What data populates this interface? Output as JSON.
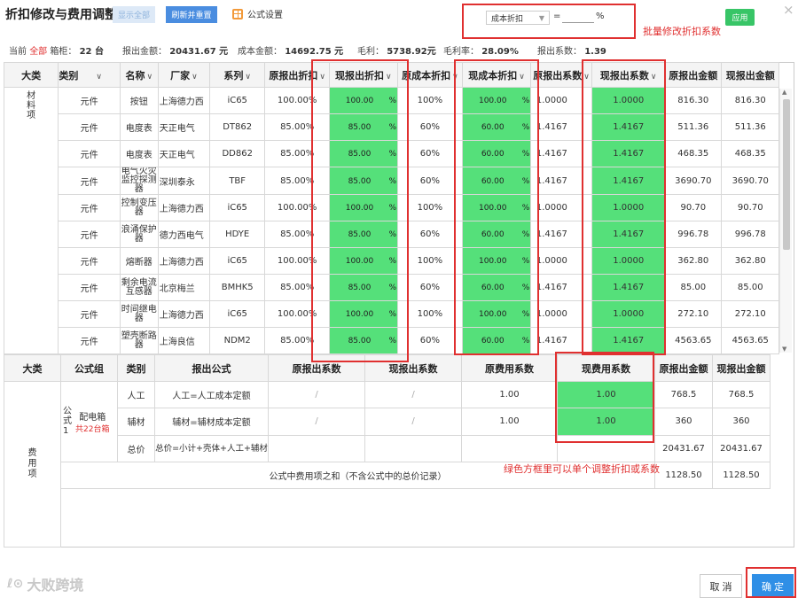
{
  "header": {
    "title": "折扣修改与费用调整",
    "show_all_label": "显示全部",
    "refresh_label": "刷新并重置",
    "formula_settings_label": "公式设置",
    "apply_label": "应用",
    "close_label": "×"
  },
  "batch": {
    "select_value": "成本折扣",
    "equals": "=",
    "input_value": "",
    "percent": "%",
    "note": "批量修改折扣系数"
  },
  "summary": {
    "current_label": "当前",
    "all_label": "全部",
    "cabinet_text": "箱柜：",
    "cabinet_value": "22 台",
    "quote_total_label": "报出金额：",
    "quote_total_value": "20431.67 元",
    "cost_total_label": "成本金额：",
    "cost_total_value": "14692.75 元",
    "gross_profit_label": "毛利：",
    "gross_profit_value": "5738.92元",
    "gross_margin_label": "毛利率：",
    "gross_margin_value": "28.09%",
    "quote_coef_label": "报出系数：",
    "quote_coef_value": "1.39"
  },
  "main_table": {
    "headers": {
      "category": "大类",
      "type": "类别",
      "name": "名称",
      "maker": "厂家",
      "series": "系列",
      "orig_quote_discount": "原报出折扣",
      "cur_quote_discount": "现报出折扣",
      "orig_cost_discount": "原成本折扣",
      "cur_cost_discount": "现成本折扣",
      "orig_quote_coef": "原报出系数",
      "cur_quote_coef": "现报出系数",
      "orig_quote_amount": "原报出金额",
      "cur_quote_amount": "现报出金额"
    },
    "category_label": "材\n料\n项",
    "rows": [
      {
        "type": "元件",
        "name": "按钮",
        "maker": "上海德力西",
        "series": "iC65",
        "oqd": "100.00%",
        "cqd": "100.00",
        "ocd": "100%",
        "ccd": "100.00",
        "oqc": "1.0000",
        "cqc": "1.0000",
        "oqa": "816.30",
        "cqa": "816.30"
      },
      {
        "type": "元件",
        "name": "电度表",
        "maker": "天正电气",
        "series": "DT862",
        "oqd": "85.00%",
        "cqd": "85.00",
        "ocd": "60%",
        "ccd": "60.00",
        "oqc": "1.4167",
        "cqc": "1.4167",
        "oqa": "511.36",
        "cqa": "511.36"
      },
      {
        "type": "元件",
        "name": "电度表",
        "maker": "天正电气",
        "series": "DD862",
        "oqd": "85.00%",
        "cqd": "85.00",
        "ocd": "60%",
        "ccd": "60.00",
        "oqc": "1.4167",
        "cqc": "1.4167",
        "oqa": "468.35",
        "cqa": "468.35"
      },
      {
        "type": "元件",
        "name": "电气火灾监控探测器",
        "maker": "深圳泰永",
        "series": "TBF",
        "oqd": "85.00%",
        "cqd": "85.00",
        "ocd": "60%",
        "ccd": "60.00",
        "oqc": "1.4167",
        "cqc": "1.4167",
        "oqa": "3690.70",
        "cqa": "3690.70"
      },
      {
        "type": "元件",
        "name": "控制变压器",
        "maker": "上海德力西",
        "series": "iC65",
        "oqd": "100.00%",
        "cqd": "100.00",
        "ocd": "100%",
        "ccd": "100.00",
        "oqc": "1.0000",
        "cqc": "1.0000",
        "oqa": "90.70",
        "cqa": "90.70"
      },
      {
        "type": "元件",
        "name": "浪涌保护器",
        "maker": "德力西电气",
        "series": "HDYE",
        "oqd": "85.00%",
        "cqd": "85.00",
        "ocd": "60%",
        "ccd": "60.00",
        "oqc": "1.4167",
        "cqc": "1.4167",
        "oqa": "996.78",
        "cqa": "996.78"
      },
      {
        "type": "元件",
        "name": "熔断器",
        "maker": "上海德力西",
        "series": "iC65",
        "oqd": "100.00%",
        "cqd": "100.00",
        "ocd": "100%",
        "ccd": "100.00",
        "oqc": "1.0000",
        "cqc": "1.0000",
        "oqa": "362.80",
        "cqa": "362.80"
      },
      {
        "type": "元件",
        "name": "剩余电流互感器",
        "maker": "北京梅兰",
        "series": "BMHK5",
        "oqd": "85.00%",
        "cqd": "85.00",
        "ocd": "60%",
        "ccd": "60.00",
        "oqc": "1.4167",
        "cqc": "1.4167",
        "oqa": "85.00",
        "cqa": "85.00"
      },
      {
        "type": "元件",
        "name": "时间继电器",
        "maker": "上海德力西",
        "series": "iC65",
        "oqd": "100.00%",
        "cqd": "100.00",
        "ocd": "100%",
        "ccd": "100.00",
        "oqc": "1.0000",
        "cqc": "1.0000",
        "oqa": "272.10",
        "cqa": "272.10"
      },
      {
        "type": "元件",
        "name": "塑壳断路器",
        "maker": "上海良信",
        "series": "NDM2",
        "oqd": "85.00%",
        "cqd": "85.00",
        "ocd": "60%",
        "ccd": "60.00",
        "oqc": "1.4167",
        "cqc": "1.4167",
        "oqa": "4563.65",
        "cqa": "4563.65"
      }
    ],
    "pct": "%"
  },
  "cost_table": {
    "headers": {
      "category": "大类",
      "formula_group": "公式组",
      "type": "类别",
      "formula": "报出公式",
      "orig_coef": "原报出系数",
      "cur_coef": "现报出系数",
      "orig_fee_coef": "原费用系数",
      "cur_fee_coef": "现费用系数",
      "orig_amount": "原报出金额",
      "cur_amount": "现报出金额"
    },
    "category_label": "费\n用\n项",
    "formula_index": "公\n式\n1",
    "group_name": "配电箱",
    "group_count": "共22台箱",
    "rows": [
      {
        "type": "人工",
        "formula": "人工=人工成本定额",
        "orig_coef": "/",
        "cur_coef": "/",
        "ofc": "1.00",
        "cfc": "1.00",
        "oa": "768.5",
        "ca": "768.5"
      },
      {
        "type": "辅材",
        "formula": "辅材=辅材成本定额",
        "orig_coef": "/",
        "cur_coef": "/",
        "ofc": "1.00",
        "cfc": "1.00",
        "oa": "360",
        "ca": "360"
      },
      {
        "type": "总价",
        "formula": "总价=小计+壳体+人工+辅材",
        "orig_coef": "",
        "cur_coef": "",
        "ofc": "",
        "cfc": "",
        "oa": "20431.67",
        "ca": "20431.67"
      }
    ],
    "sum_label": "公式中费用项之和（不含公式中的总价记录）",
    "sum_orig": "1128.50",
    "sum_cur": "1128.50",
    "green_note": "绿色方框里可以单个调整折扣或系数"
  },
  "footer": {
    "watermark": "大败跨境",
    "cancel_label": "取 消",
    "ok_label": "确 定"
  },
  "colors": {
    "green": "#55e07a",
    "red_annotation": "#e03030",
    "primary_blue": "#2f8fe6",
    "apply_green": "#38c567"
  }
}
